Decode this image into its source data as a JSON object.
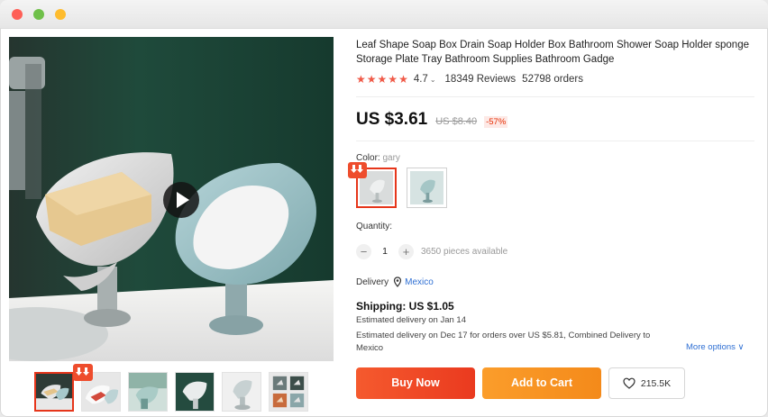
{
  "window": {
    "controls": [
      "close",
      "minimize",
      "zoom"
    ]
  },
  "gallery": {
    "main_image_alt": "Leaf shaped soap holders",
    "play_icon": "play-icon",
    "thumbnail_count": 6
  },
  "product": {
    "title": "Leaf Shape Soap Box Drain Soap Holder Box Bathroom Shower Soap Holder sponge Storage Plate Tray Bathroom Supplies Bathroom Gadge",
    "rating": {
      "stars": 5,
      "value": "4.7",
      "reviews": "18349 Reviews",
      "orders": "52798 orders"
    },
    "price": {
      "current": "US $3.61",
      "original": "US $8.40",
      "discount": "-57%"
    },
    "color": {
      "label": "Color: ",
      "selected": "gary",
      "options": [
        "gary",
        "green"
      ]
    },
    "quantity": {
      "label": "Quantity:",
      "minus": "−",
      "plus": "+",
      "value": "1",
      "available": "3650 pieces available"
    },
    "delivery": {
      "label": "Delivery",
      "country": "Mexico"
    },
    "shipping": {
      "title": "Shipping: US $1.05",
      "estimate": "Estimated delivery on Jan 14",
      "estimate_combined": "Estimated delivery on Dec 17 for orders over US $5.81, Combined Delivery to Mexico",
      "more_options": "More options ∨"
    },
    "actions": {
      "buy_now": "Buy Now",
      "add_to_cart": "Add to Cart",
      "wishlist_count": "215.5K"
    }
  },
  "colors": {
    "accent": "#ea3a1f",
    "cart": "#f48a1a",
    "star": "#f05a48",
    "link": "#2e6fd3"
  }
}
